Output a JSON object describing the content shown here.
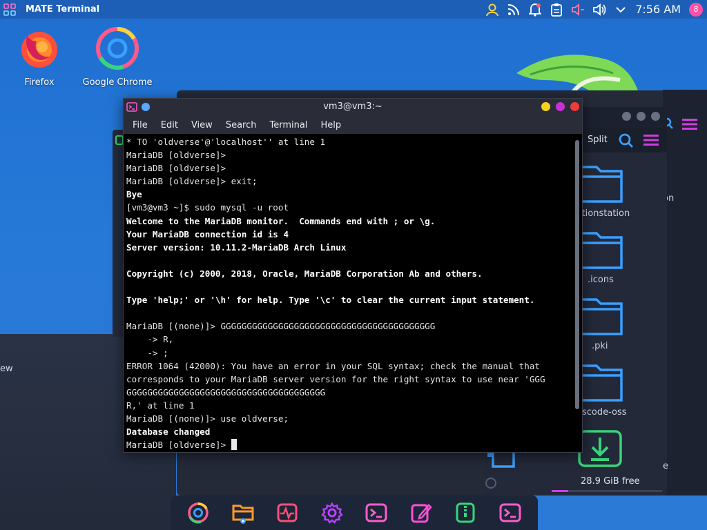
{
  "panel": {
    "app_title": "MATE Terminal",
    "clock": "7:56 AM",
    "user_initial": "8",
    "tray_icons": [
      "user-icon",
      "rss-icon",
      "notification-bell-icon",
      "clipboard-icon",
      "volume-muted-icon",
      "volume-icon",
      "chevron-down-icon"
    ]
  },
  "desktop": {
    "icons": [
      {
        "label": "Firefox"
      },
      {
        "label": "Google Chrome"
      }
    ]
  },
  "file_manager": {
    "split_label": "Split",
    "folders": [
      "lationstation",
      ".icons",
      ".pki",
      "scode-oss"
    ],
    "partial_labels": [
      "on",
      "e"
    ],
    "free_space": "28.9 GiB free",
    "usage_fraction": 0.15
  },
  "left_window": {
    "partial_label": "ew"
  },
  "terminal": {
    "title": "vm3@vm3:~",
    "menu": [
      "File",
      "Edit",
      "View",
      "Search",
      "Terminal",
      "Help"
    ],
    "lines": [
      {
        "text": "* TO 'oldverse'@'localhost'' at line 1",
        "bold": false
      },
      {
        "text": "MariaDB [oldverse]>",
        "bold": false
      },
      {
        "text": "MariaDB [oldverse]>",
        "bold": false
      },
      {
        "text": "MariaDB [oldverse]> exit;",
        "bold": false
      },
      {
        "text": "Bye",
        "bold": true
      },
      {
        "text": "[vm3@vm3 ~]$ sudo mysql -u root",
        "bold": false
      },
      {
        "text": "Welcome to the MariaDB monitor.  Commands end with ; or \\g.",
        "bold": true
      },
      {
        "text": "Your MariaDB connection id is 4",
        "bold": true
      },
      {
        "text": "Server version: 10.11.2-MariaDB Arch Linux",
        "bold": true
      },
      {
        "text": "",
        "bold": false
      },
      {
        "text": "Copyright (c) 2000, 2018, Oracle, MariaDB Corporation Ab and others.",
        "bold": true
      },
      {
        "text": "",
        "bold": false
      },
      {
        "text": "Type 'help;' or '\\h' for help. Type '\\c' to clear the current input statement.",
        "bold": true
      },
      {
        "text": "",
        "bold": false
      },
      {
        "text": "MariaDB [(none)]> GGGGGGGGGGGGGGGGGGGGGGGGGGGGGGGGGGGGGGGGG",
        "bold": false
      },
      {
        "text": "    -> R,",
        "bold": false
      },
      {
        "text": "    -> ;",
        "bold": false
      },
      {
        "text": "ERROR 1064 (42000): You have an error in your SQL syntax; check the manual that",
        "bold": false
      },
      {
        "text": "corresponds to your MariaDB server version for the right syntax to use near 'GGG",
        "bold": false
      },
      {
        "text": "GGGGGGGGGGGGGGGGGGGGGGGGGGGGGGGGGGGGGG",
        "bold": false
      },
      {
        "text": "R,' at line 1",
        "bold": false
      },
      {
        "text": "MariaDB [(none)]> use oldverse;",
        "bold": false
      },
      {
        "text": "Database changed",
        "bold": true
      },
      {
        "text": "MariaDB [oldverse]> ",
        "bold": false,
        "cursor": true
      }
    ]
  },
  "dock": {
    "items": [
      "chrome-icon",
      "file-manager-icon",
      "system-monitor-icon",
      "settings-icon",
      "terminal-icon",
      "text-editor-icon",
      "archive-icon",
      "terminal-icon"
    ]
  },
  "colors": {
    "accent": "#d13de0",
    "desktop_blue": "#2779d8",
    "close": "#ef3b3b",
    "maximize": "#c531d9",
    "minimize": "#f4d21f"
  }
}
